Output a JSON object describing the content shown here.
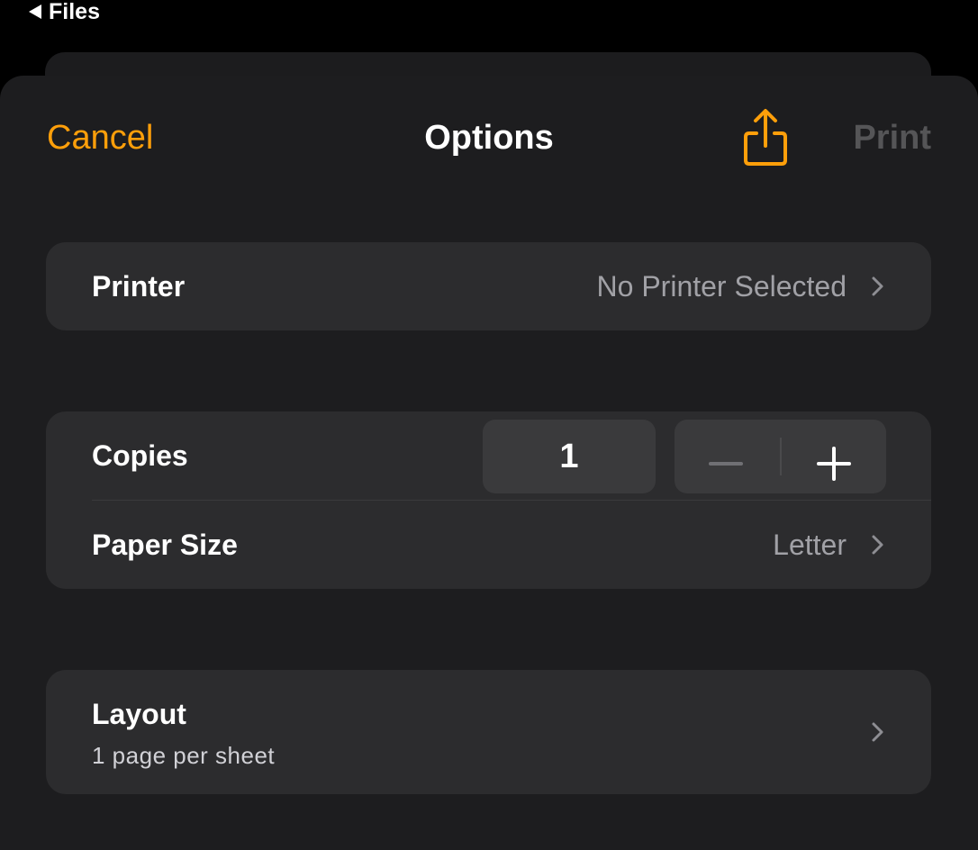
{
  "status_bar": {
    "back_label": "Files"
  },
  "nav": {
    "cancel_label": "Cancel",
    "title": "Options",
    "share_icon": "share-icon",
    "print_label": "Print"
  },
  "printer": {
    "label": "Printer",
    "value": "No Printer Selected"
  },
  "copies": {
    "label": "Copies",
    "value": "1",
    "decrement_icon": "minus-icon",
    "increment_icon": "plus-icon"
  },
  "paper_size": {
    "label": "Paper Size",
    "value": "Letter"
  },
  "layout": {
    "label": "Layout",
    "value": "1 page per sheet"
  },
  "colors": {
    "accent": "#ff9f0a",
    "background": "#000000",
    "sheet": "#1d1d1f",
    "card": "#2c2c2e",
    "disabled_text": "#555557",
    "secondary_text": "#a1a1a6"
  }
}
